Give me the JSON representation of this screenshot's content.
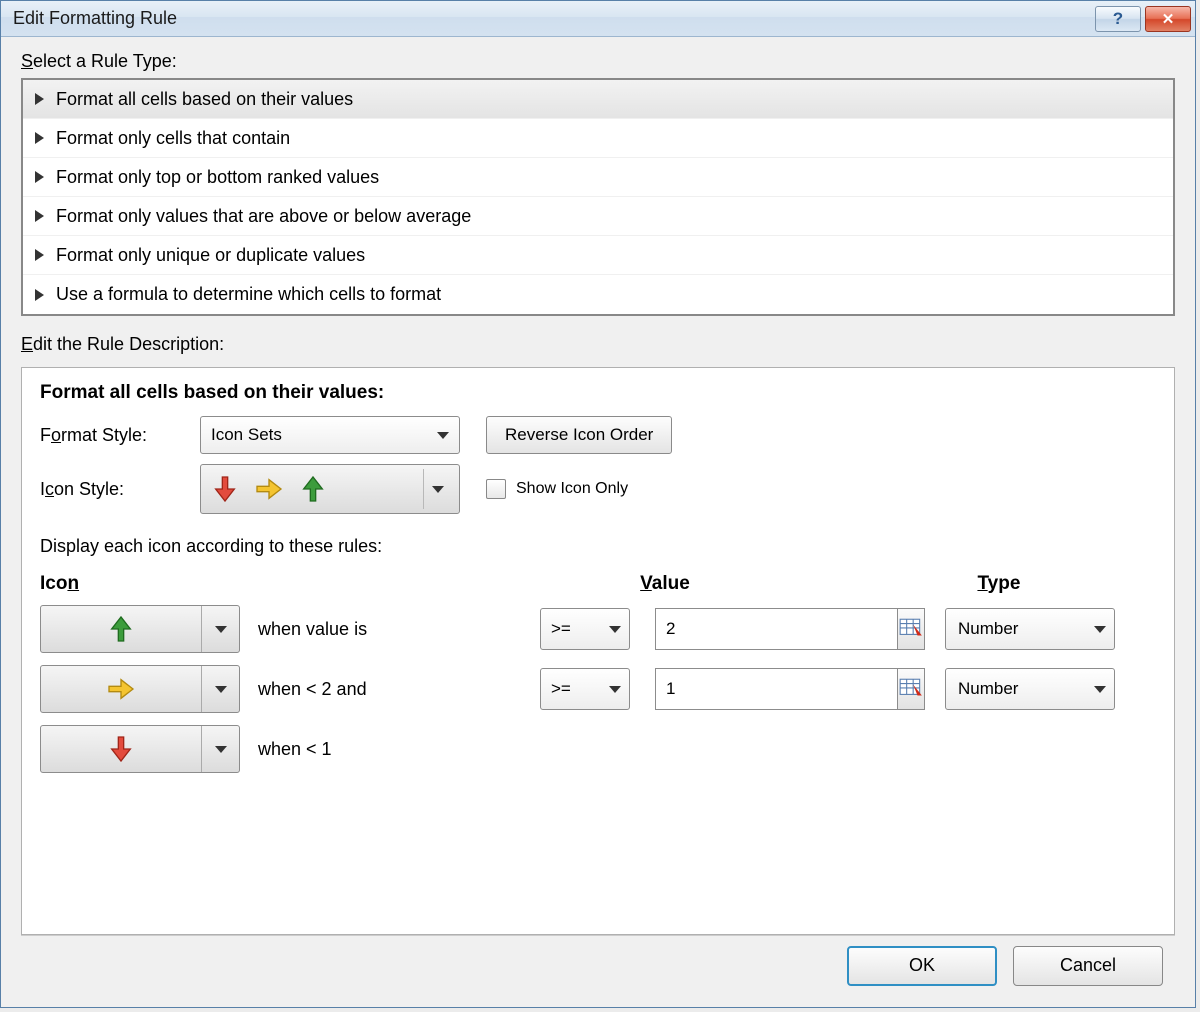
{
  "title": "Edit Formatting Rule",
  "rule_type": {
    "label_pre": "S",
    "label_rest": "elect a Rule Type:",
    "items": [
      "Format all cells based on their values",
      "Format only cells that contain",
      "Format only top or bottom ranked values",
      "Format only values that are above or below average",
      "Format only unique or duplicate values",
      "Use a formula to determine which cells to format"
    ],
    "selected_index": 0
  },
  "desc_label_pre": "E",
  "desc_label_rest": "dit the Rule Description:",
  "desc": {
    "header": "Format all cells based on their values:",
    "format_style_label_pre": "F",
    "format_style_label_u": "o",
    "format_style_label_rest": "rmat Style:",
    "format_style_value": "Icon Sets",
    "reverse_label": "Reverse Icon Order",
    "icon_style_label_pre": "I",
    "icon_style_label_u": "c",
    "icon_style_label_rest": "on Style:",
    "show_icon_only_pre": "Show ",
    "show_icon_only_u": "I",
    "show_icon_only_rest": "con Only",
    "show_icon_only_checked": false,
    "rules_intro": "Display each icon according to these rules:",
    "head_icon_pre": "Ico",
    "head_icon_u": "n",
    "head_value_u": "V",
    "head_value_rest": "alue",
    "head_type_u": "T",
    "head_type_rest": "ype",
    "rows": [
      {
        "when": "when value is",
        "op": ">=",
        "value": "2",
        "type": "Number"
      },
      {
        "when": "when < 2 and",
        "op": ">=",
        "value": "1",
        "type": "Number"
      },
      {
        "when": "when < 1"
      }
    ]
  },
  "ok": "OK",
  "cancel": "Cancel"
}
